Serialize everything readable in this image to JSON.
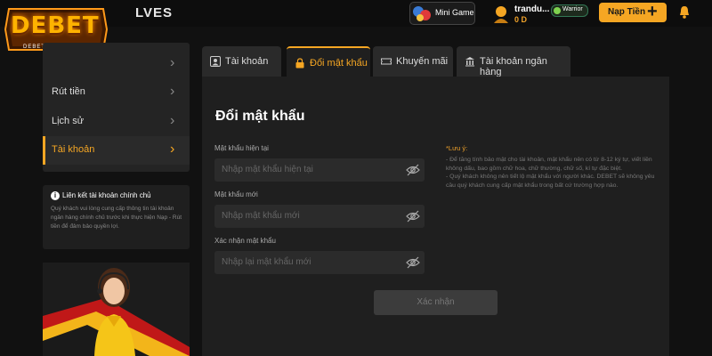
{
  "header": {
    "logo_text": "DEBET",
    "logo_sub": "DEBET.AIRFORCE",
    "brand_tail": "LVES",
    "minigame_label": "Mini Game",
    "user_name": "trandu...",
    "balance": "0 D",
    "rank": "Warrior",
    "deposit_label": "Nạp Tiền"
  },
  "sidebar": {
    "items": [
      {
        "label": ""
      },
      {
        "label": "Rút tiền"
      },
      {
        "label": "Lịch sử"
      },
      {
        "label": "Tài khoản"
      }
    ],
    "info_title": "Liên kết tài khoản chính chủ",
    "info_body": "Quý khách vui lòng cung cấp thông tin tài khoản ngân hàng chính chủ trước khi thực hiện Nạp - Rút tiền để đảm bảo quyền lợi."
  },
  "tabs": [
    {
      "label": "Tài khoản",
      "icon": "user-card-icon"
    },
    {
      "label": "Đổi mật khẩu",
      "icon": "lock-icon"
    },
    {
      "label": "Khuyến mãi",
      "icon": "ticket-icon"
    },
    {
      "label": "Tài khoản ngân hàng",
      "icon": "bank-icon"
    }
  ],
  "form": {
    "title": "Đổi mật khẩu",
    "current_label": "Mật khẩu hiện tại",
    "current_placeholder": "Nhập mật khẩu hiện tại",
    "new_label": "Mật khẩu mới",
    "new_placeholder": "Nhập mật khẩu mới",
    "confirm_label": "Xác nhận mật khẩu",
    "confirm_placeholder": "Nhập lại mật khẩu mới",
    "submit_label": "Xác nhận"
  },
  "note": {
    "title": "*Lưu ý:",
    "line1": "- Để tăng tính bảo mật cho tài khoản, mật khẩu nên có từ 8-12 ký tự, viết liền không dấu, bao gồm chữ hoa, chữ thường, chữ số, kí tự đặc biệt.",
    "line2": "- Quý khách không nên tiết lộ mật khẩu với người khác. DEBET sẽ không yêu cầu quý khách cung cấp mật khẩu trong bất cứ trường hợp nào."
  },
  "colors": {
    "accent": "#f5a623",
    "panel": "#1f1f1f",
    "background": "#111111"
  }
}
